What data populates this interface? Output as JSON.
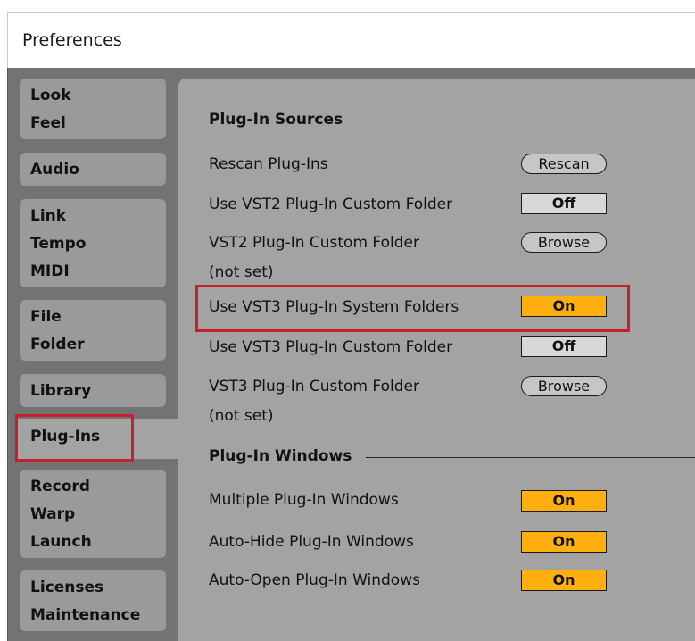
{
  "window": {
    "title": "Preferences"
  },
  "tabs": [
    {
      "lines": [
        "Look",
        "Feel"
      ]
    },
    {
      "lines": [
        "Audio"
      ]
    },
    {
      "lines": [
        "Link",
        "Tempo",
        "MIDI"
      ]
    },
    {
      "lines": [
        "File",
        "Folder"
      ]
    },
    {
      "lines": [
        "Library"
      ]
    },
    {
      "lines": [
        "Plug-Ins"
      ]
    },
    {
      "lines": [
        "Record",
        "Warp",
        "Launch"
      ]
    },
    {
      "lines": [
        "Licenses",
        "Maintenance"
      ]
    }
  ],
  "active_tab": "Plug-Ins",
  "plugin_sources": {
    "heading": "Plug-In Sources",
    "rescan_label": "Rescan Plug-Ins",
    "rescan_button": "Rescan",
    "vst2_custom_folder_toggle_label": "Use VST2 Plug-In Custom Folder",
    "vst2_custom_folder_toggle_value": "Off",
    "vst2_folder_label": "VST2 Plug-In Custom Folder",
    "vst2_folder_browse": "Browse",
    "vst2_folder_value": "(not set)",
    "vst3_system_folders_label": "Use VST3 Plug-In System Folders",
    "vst3_system_folders_value": "On",
    "vst3_custom_folder_toggle_label": "Use VST3 Plug-In Custom Folder",
    "vst3_custom_folder_toggle_value": "Off",
    "vst3_folder_label": "VST3 Plug-In Custom Folder",
    "vst3_folder_browse": "Browse",
    "vst3_folder_value": "(not set)"
  },
  "plugin_windows": {
    "heading": "Plug-In Windows",
    "multiple_label": "Multiple Plug-In Windows",
    "multiple_value": "On",
    "autohide_label": "Auto-Hide Plug-In Windows",
    "autohide_value": "On",
    "autoopen_label": "Auto-Open Plug-In Windows",
    "autoopen_value": "On"
  },
  "colors": {
    "toggle_on": "#ffb00e",
    "toggle_off": "#d8d8d8",
    "highlight": "#c8202a",
    "panel": "#a3a3a3",
    "background": "#737373"
  }
}
